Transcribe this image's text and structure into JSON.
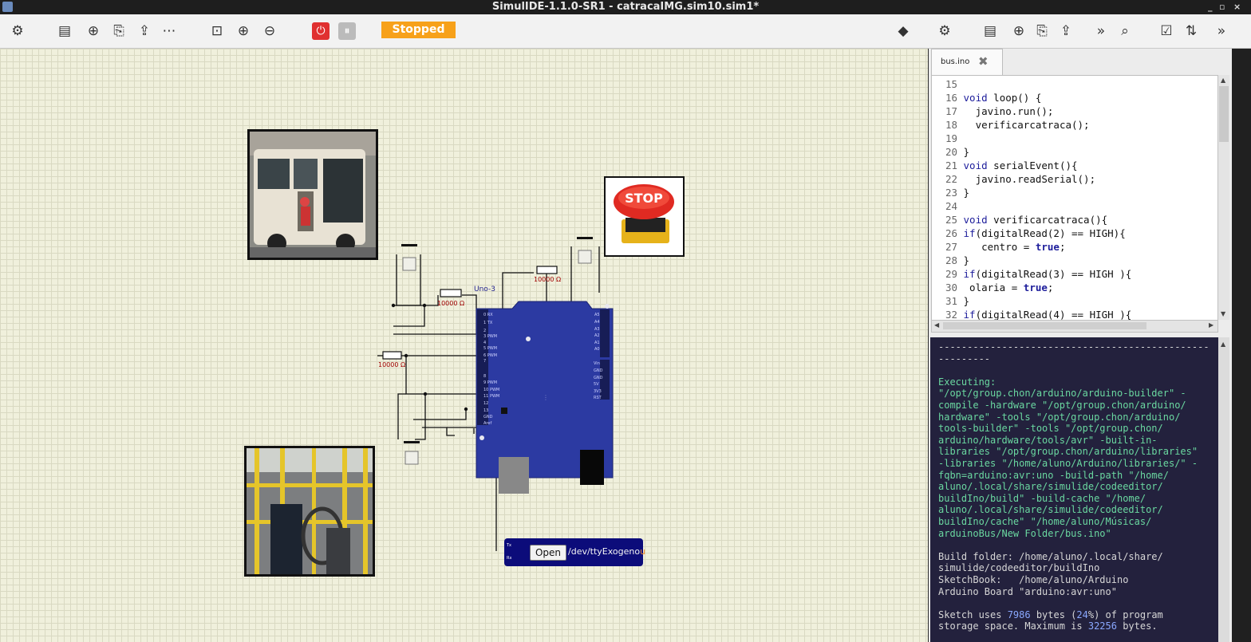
{
  "window": {
    "title": "SimulIDE-1.1.0-SR1 - catracaIMG.sim10.sim1*",
    "controls": [
      "_",
      "▫",
      "×"
    ]
  },
  "toolbar": {
    "left_icons": [
      "gear-icon",
      "new-circuit-icon",
      "new-file-icon",
      "open-icon",
      "save-icon",
      "save-as-icon",
      "zoom-fit-icon",
      "zoom-in-icon",
      "zoom-out-icon",
      "power-icon",
      "pause-icon"
    ],
    "status": "Stopped",
    "right_icons": [
      "debug-icon",
      "gear-icon",
      "new-file-icon",
      "new-icon",
      "open-icon",
      "save-icon",
      "more-icon",
      "search-icon",
      "check-icon",
      "upload-icon",
      "more-icon"
    ]
  },
  "canvas": {
    "board_label": "Uno-3",
    "resistor_label": "10000 Ω",
    "serial": {
      "button": "Open",
      "port_prefix": "/dev/ttyExogeno",
      "port_suffix": "u",
      "pin_tx": "Tx",
      "pin_rx": "Rx"
    },
    "stop_button_text": "STOP"
  },
  "editor": {
    "tab_label": "bus.ino",
    "lines": [
      {
        "n": "15",
        "t": ""
      },
      {
        "n": "16",
        "k": "void",
        "t": " loop() {"
      },
      {
        "n": "17",
        "t": "  javino.run();"
      },
      {
        "n": "18",
        "t": "  verificarcatraca();"
      },
      {
        "n": "19",
        "t": ""
      },
      {
        "n": "20",
        "t": "}"
      },
      {
        "n": "21",
        "k": "void",
        "t": " serialEvent(){"
      },
      {
        "n": "22",
        "t": "  javino.readSerial();"
      },
      {
        "n": "23",
        "t": "}"
      },
      {
        "n": "24",
        "t": ""
      },
      {
        "n": "25",
        "k": "void",
        "t": " verificarcatraca(){"
      },
      {
        "n": "26",
        "k": "if",
        "t": "(digitalRead(2) == HIGH){"
      },
      {
        "n": "27",
        "t": "   centro = ",
        "k2": "true",
        "t2": ";"
      },
      {
        "n": "28",
        "t": "}"
      },
      {
        "n": "29",
        "k": "if",
        "t": "(digitalRead(3) == HIGH ){"
      },
      {
        "n": "30",
        "t": " olaria = ",
        "k2": "true",
        "t2": ";"
      },
      {
        "n": "31",
        "t": "}"
      },
      {
        "n": "32",
        "k": "if",
        "t": "(digitalRead(4) == HIGH ){"
      }
    ]
  },
  "output": {
    "lines": [
      {
        "c": "w",
        "t": "-----------------------------------------------"
      },
      {
        "c": "w",
        "t": "---------"
      },
      {
        "c": "",
        "t": ""
      },
      {
        "c": "",
        "t": "Executing:"
      },
      {
        "c": "",
        "t": "\"/opt/group.chon/arduino/arduino-builder\" -"
      },
      {
        "c": "",
        "t": "compile -hardware \"/opt/group.chon/arduino/"
      },
      {
        "c": "",
        "t": "hardware\" -tools \"/opt/group.chon/arduino/"
      },
      {
        "c": "",
        "t": "tools-builder\" -tools \"/opt/group.chon/"
      },
      {
        "c": "",
        "t": "arduino/hardware/tools/avr\" -built-in-"
      },
      {
        "c": "",
        "t": "libraries \"/opt/group.chon/arduino/libraries\""
      },
      {
        "c": "",
        "t": "-libraries \"/home/aluno/Arduino/libraries/\" -"
      },
      {
        "c": "",
        "t": "fqbn=arduino:avr:uno -build-path \"/home/"
      },
      {
        "c": "",
        "t": "aluno/.local/share/simulide/codeeditor/"
      },
      {
        "c": "",
        "t": "buildIno/build\" -build-cache \"/home/"
      },
      {
        "c": "",
        "t": "aluno/.local/share/simulide/codeeditor/"
      },
      {
        "c": "",
        "t": "buildIno/cache\" \"/home/aluno/Músicas/"
      },
      {
        "c": "",
        "t": "arduinoBus/New Folder/bus.ino\""
      },
      {
        "c": "",
        "t": ""
      },
      {
        "c": "w",
        "t": "Build folder: /home/aluno/.local/share/"
      },
      {
        "c": "w",
        "t": "simulide/codeeditor/buildIno"
      },
      {
        "c": "w",
        "t": "SketchBook:   /home/aluno/Arduino"
      },
      {
        "c": "w",
        "t": "Arduino Board \"arduino:avr:uno\""
      },
      {
        "c": "",
        "t": ""
      },
      {
        "c": "w",
        "t": "Sketch uses 7986 bytes (24%) of program"
      },
      {
        "c": "w",
        "t": "storage space. Maximum is 32256 bytes."
      }
    ]
  }
}
